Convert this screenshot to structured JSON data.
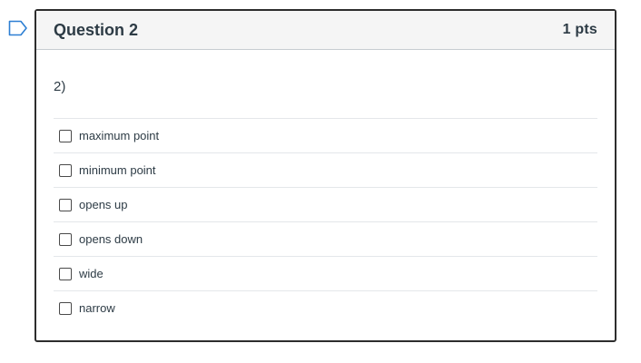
{
  "question": {
    "title": "Question 2",
    "points": "1 pts",
    "text": "2)",
    "answers": [
      "maximum point",
      "minimum point",
      "opens up",
      "opens down",
      "wide",
      "narrow"
    ]
  },
  "icons": {
    "flag": "flag-outline-icon"
  },
  "colors": {
    "text": "#2d3b45",
    "header_bg": "#f5f5f5",
    "flag": "#2d7fd3"
  }
}
